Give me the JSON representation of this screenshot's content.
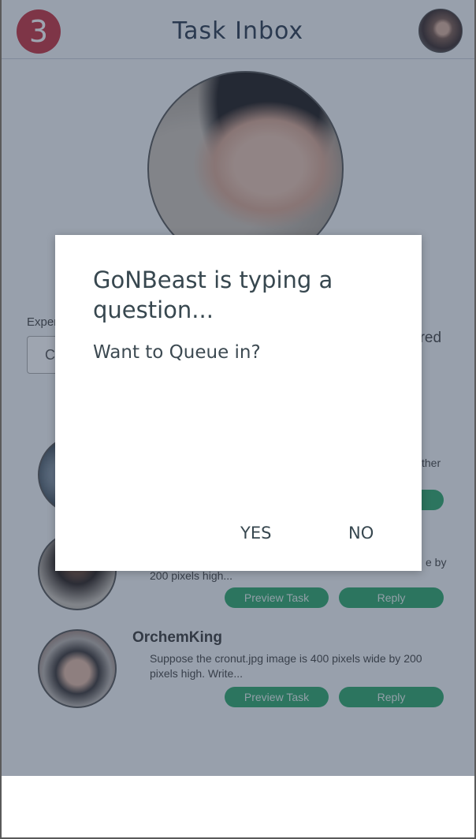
{
  "header": {
    "badge_count": "3",
    "title": "Task Inbox"
  },
  "profile": {
    "experience_label": "Exper",
    "experience_value": "C",
    "answered_text": "ered"
  },
  "tasks": [
    {
      "name": "",
      "description": "ther",
      "preview_label": "",
      "reply_label": ""
    },
    {
      "name": "",
      "description_tail": "e by",
      "description": "200 pixels high...",
      "preview_label": "Preview Task",
      "reply_label": "Reply"
    },
    {
      "name": "OrchemKing",
      "description": "Suppose the cronut.jpg image is 400 pixels wide by 200 pixels high. Write...",
      "preview_label": "Preview Task",
      "reply_label": "Reply"
    }
  ],
  "dialog": {
    "title": "GoNBeast is typing a question...",
    "message": "Want to Queue in?",
    "yes_label": "YES",
    "no_label": "NO"
  },
  "colors": {
    "accent_green": "#2ea66a",
    "badge_red": "#c4303e",
    "overlay": "rgba(44,58,82,0.46)"
  }
}
